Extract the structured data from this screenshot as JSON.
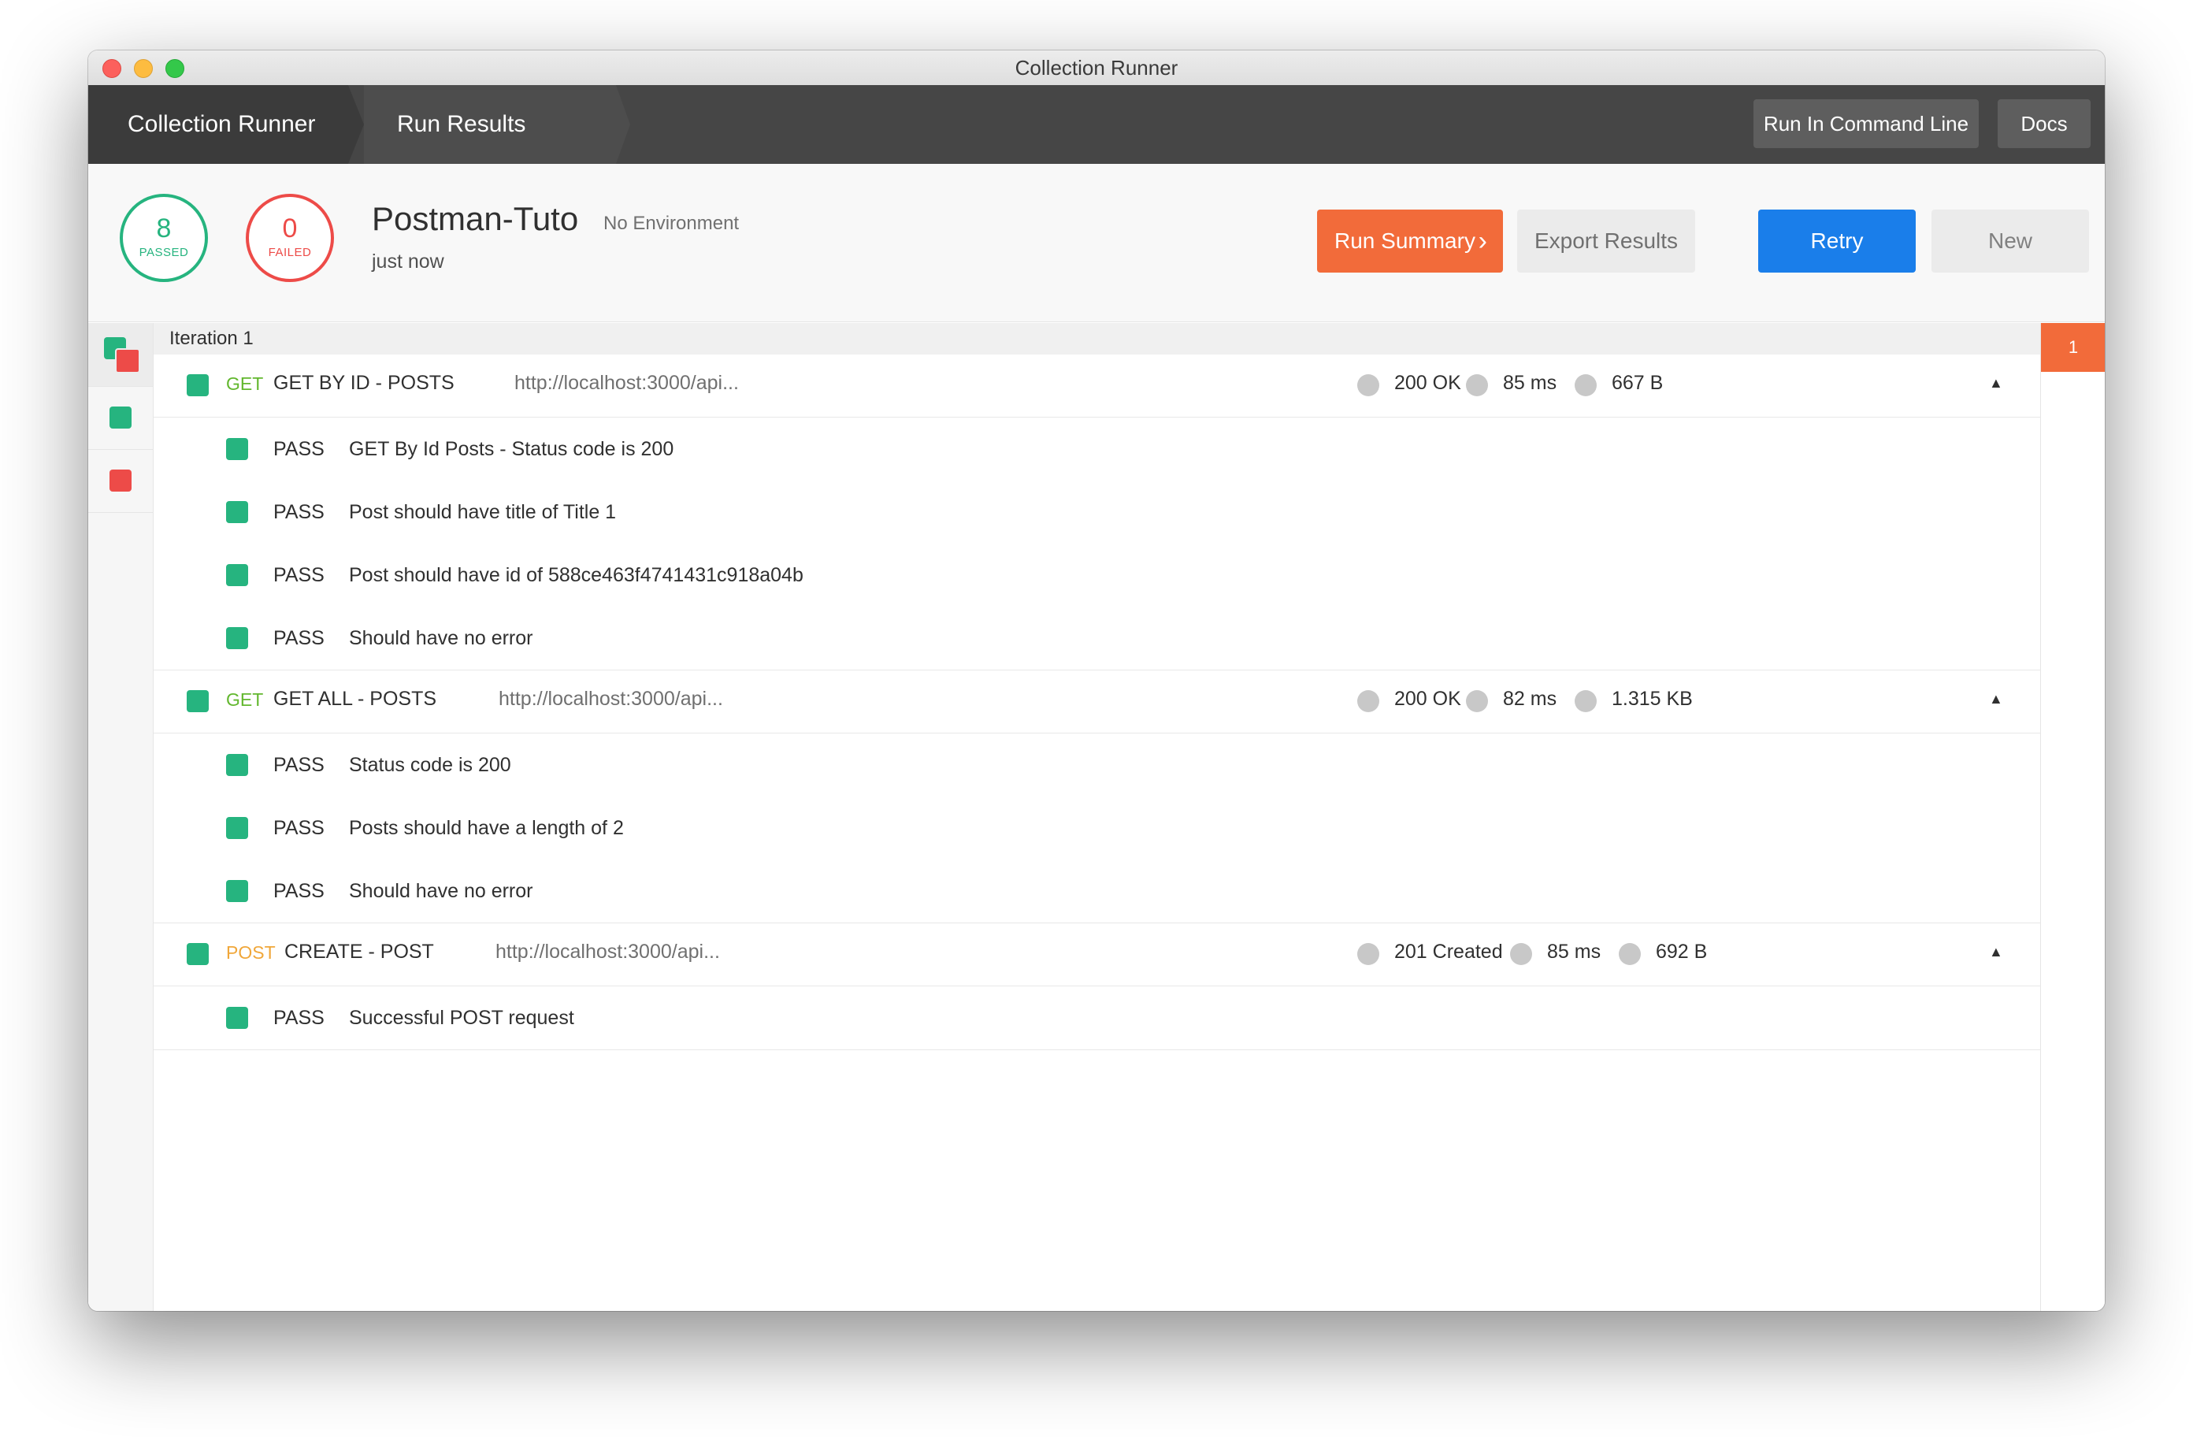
{
  "window": {
    "title": "Collection Runner"
  },
  "header": {
    "tabs": [
      {
        "label": "Collection Runner"
      },
      {
        "label": "Run Results"
      }
    ],
    "buttons": {
      "command_line": "Run In Command Line",
      "docs": "Docs"
    }
  },
  "summary": {
    "passed_count": "8",
    "passed_label": "PASSED",
    "failed_count": "0",
    "failed_label": "FAILED",
    "collection_name": "Postman-Tuto",
    "environment": "No Environment",
    "time": "just now",
    "run_summary_label": "Run Summary",
    "export_label": "Export Results",
    "retry_label": "Retry",
    "new_label": "New"
  },
  "iteration": {
    "label": "Iteration 1",
    "badge": "1"
  },
  "requests": [
    {
      "method": "GET",
      "name": "GET BY ID - POSTS",
      "url": "http://localhost:3000/api...",
      "status": "200 OK",
      "time": "85 ms",
      "size": "667 B",
      "tests": [
        {
          "result": "PASS",
          "name": "GET By Id Posts - Status code is 200"
        },
        {
          "result": "PASS",
          "name": "Post should have title of Title 1"
        },
        {
          "result": "PASS",
          "name": "Post should have id of 588ce463f4741431c918a04b"
        },
        {
          "result": "PASS",
          "name": "Should have no error"
        }
      ]
    },
    {
      "method": "GET",
      "name": "GET ALL - POSTS",
      "url": "http://localhost:3000/api...",
      "status": "200 OK",
      "time": "82 ms",
      "size": "1.315 KB",
      "tests": [
        {
          "result": "PASS",
          "name": "Status code is 200"
        },
        {
          "result": "PASS",
          "name": "Posts should have a length of 2"
        },
        {
          "result": "PASS",
          "name": "Should have no error"
        }
      ]
    },
    {
      "method": "POST",
      "name": "CREATE - POST",
      "url": "http://localhost:3000/api...",
      "status": "201 Created",
      "time": "85 ms",
      "size": "692 B",
      "tests": [
        {
          "result": "PASS",
          "name": "Successful POST request"
        }
      ]
    }
  ],
  "colors": {
    "pass": "#26b47f",
    "fail": "#ed4b48",
    "accent_orange": "#f26b3a",
    "retry_blue": "#1a7eea",
    "method_get": "#62b72e",
    "method_post": "#f0a73a"
  }
}
